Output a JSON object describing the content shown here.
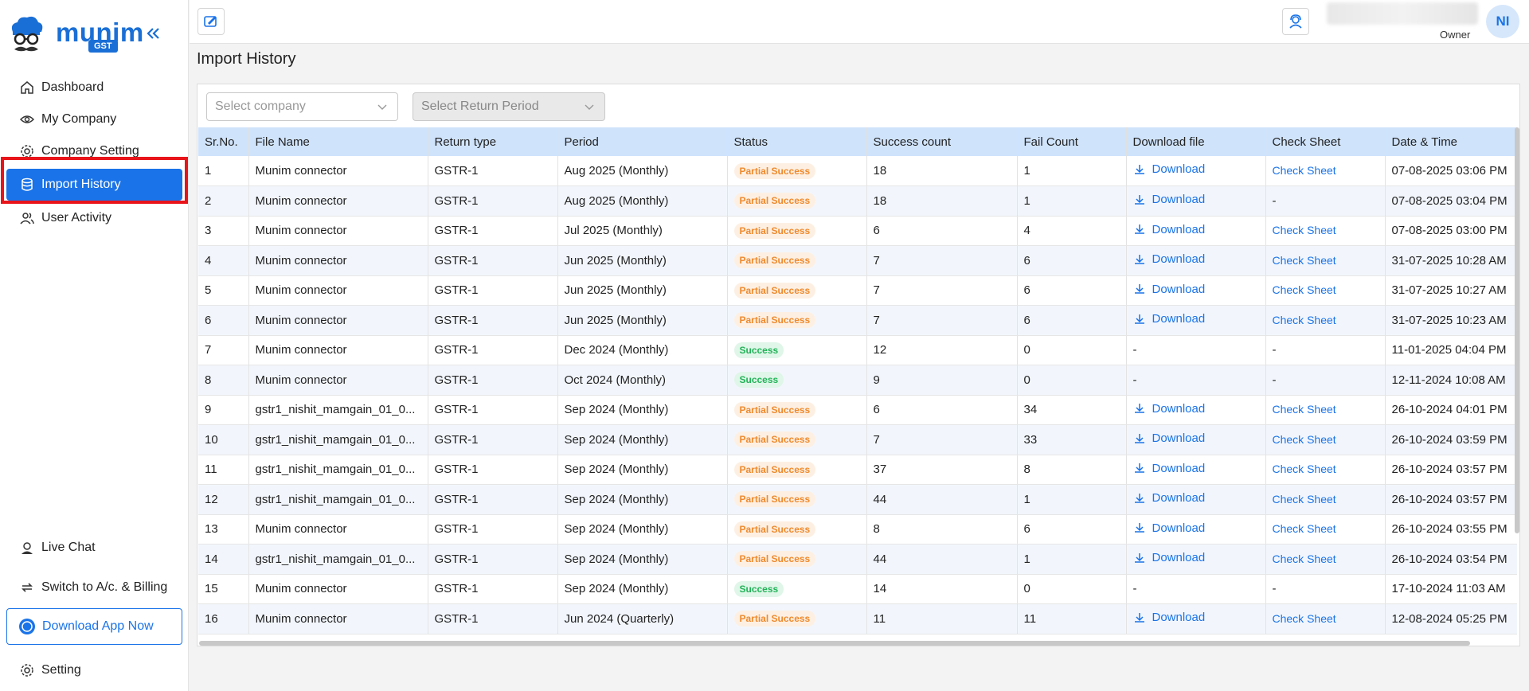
{
  "brand": {
    "name": "munim",
    "badge": "GST",
    "color": "#1a6fd6"
  },
  "sidebar": {
    "items": [
      {
        "label": "Dashboard",
        "icon": "home-icon"
      },
      {
        "label": "My Company",
        "icon": "eye-icon"
      },
      {
        "label": "Company Setting",
        "icon": "gear-icon"
      },
      {
        "label": "Import History",
        "icon": "database-icon",
        "active": true
      },
      {
        "label": "User Activity",
        "icon": "users-icon"
      }
    ],
    "bottom": {
      "live_chat": "Live Chat",
      "switch": "Switch to A/c. & Billing",
      "download_app": "Download App Now",
      "setting": "Setting"
    }
  },
  "topbar": {
    "role": "Owner",
    "avatar_initials": "NI"
  },
  "page": {
    "title": "Import History"
  },
  "filters": {
    "company_placeholder": "Select company",
    "period_placeholder": "Select Return Period"
  },
  "table": {
    "headers": [
      "Sr.No.",
      "File Name",
      "Return type",
      "Period",
      "Status",
      "Success count",
      "Fail Count",
      "Download file",
      "Check Sheet",
      "Date & Time"
    ],
    "download_label": "Download",
    "check_label": "Check Sheet",
    "rows": [
      {
        "sr": "1",
        "file": "Munim connector",
        "type": "GSTR-1",
        "period": "Aug 2025 (Monthly)",
        "status": "Partial Success",
        "success": "18",
        "fail": "1",
        "download": true,
        "check": true,
        "date": "07-08-2025 03:06 PM"
      },
      {
        "sr": "2",
        "file": "Munim connector",
        "type": "GSTR-1",
        "period": "Aug 2025 (Monthly)",
        "status": "Partial Success",
        "success": "18",
        "fail": "1",
        "download": true,
        "check": false,
        "date": "07-08-2025 03:04 PM"
      },
      {
        "sr": "3",
        "file": "Munim connector",
        "type": "GSTR-1",
        "period": "Jul 2025 (Monthly)",
        "status": "Partial Success",
        "success": "6",
        "fail": "4",
        "download": true,
        "check": true,
        "date": "07-08-2025 03:00 PM"
      },
      {
        "sr": "4",
        "file": "Munim connector",
        "type": "GSTR-1",
        "period": "Jun 2025 (Monthly)",
        "status": "Partial Success",
        "success": "7",
        "fail": "6",
        "download": true,
        "check": true,
        "date": "31-07-2025 10:28 AM"
      },
      {
        "sr": "5",
        "file": "Munim connector",
        "type": "GSTR-1",
        "period": "Jun 2025 (Monthly)",
        "status": "Partial Success",
        "success": "7",
        "fail": "6",
        "download": true,
        "check": true,
        "date": "31-07-2025 10:27 AM"
      },
      {
        "sr": "6",
        "file": "Munim connector",
        "type": "GSTR-1",
        "period": "Jun 2025 (Monthly)",
        "status": "Partial Success",
        "success": "7",
        "fail": "6",
        "download": true,
        "check": true,
        "date": "31-07-2025 10:23 AM"
      },
      {
        "sr": "7",
        "file": "Munim connector",
        "type": "GSTR-1",
        "period": "Dec 2024 (Monthly)",
        "status": "Success",
        "success": "12",
        "fail": "0",
        "download": false,
        "check": false,
        "date": "11-01-2025 04:04 PM"
      },
      {
        "sr": "8",
        "file": "Munim connector",
        "type": "GSTR-1",
        "period": "Oct 2024 (Monthly)",
        "status": "Success",
        "success": "9",
        "fail": "0",
        "download": false,
        "check": false,
        "date": "12-11-2024 10:08 AM"
      },
      {
        "sr": "9",
        "file": "gstr1_nishit_mamgain_01_0...",
        "type": "GSTR-1",
        "period": "Sep 2024 (Monthly)",
        "status": "Partial Success",
        "success": "6",
        "fail": "34",
        "download": true,
        "check": true,
        "date": "26-10-2024 04:01 PM"
      },
      {
        "sr": "10",
        "file": "gstr1_nishit_mamgain_01_0...",
        "type": "GSTR-1",
        "period": "Sep 2024 (Monthly)",
        "status": "Partial Success",
        "success": "7",
        "fail": "33",
        "download": true,
        "check": true,
        "date": "26-10-2024 03:59 PM"
      },
      {
        "sr": "11",
        "file": "gstr1_nishit_mamgain_01_0...",
        "type": "GSTR-1",
        "period": "Sep 2024 (Monthly)",
        "status": "Partial Success",
        "success": "37",
        "fail": "8",
        "download": true,
        "check": true,
        "date": "26-10-2024 03:57 PM"
      },
      {
        "sr": "12",
        "file": "gstr1_nishit_mamgain_01_0...",
        "type": "GSTR-1",
        "period": "Sep 2024 (Monthly)",
        "status": "Partial Success",
        "success": "44",
        "fail": "1",
        "download": true,
        "check": true,
        "date": "26-10-2024 03:57 PM"
      },
      {
        "sr": "13",
        "file": "Munim connector",
        "type": "GSTR-1",
        "period": "Sep 2024 (Monthly)",
        "status": "Partial Success",
        "success": "8",
        "fail": "6",
        "download": true,
        "check": true,
        "date": "26-10-2024 03:55 PM"
      },
      {
        "sr": "14",
        "file": "gstr1_nishit_mamgain_01_0...",
        "type": "GSTR-1",
        "period": "Sep 2024 (Monthly)",
        "status": "Partial Success",
        "success": "44",
        "fail": "1",
        "download": true,
        "check": true,
        "date": "26-10-2024 03:54 PM"
      },
      {
        "sr": "15",
        "file": "Munim connector",
        "type": "GSTR-1",
        "period": "Sep 2024 (Monthly)",
        "status": "Success",
        "success": "14",
        "fail": "0",
        "download": false,
        "check": false,
        "date": "17-10-2024 11:03 AM"
      },
      {
        "sr": "16",
        "file": "Munim connector",
        "type": "GSTR-1",
        "period": "Jun 2024 (Quarterly)",
        "status": "Partial Success",
        "success": "11",
        "fail": "11",
        "download": true,
        "check": true,
        "date": "12-08-2024 05:25 PM"
      }
    ],
    "empty_cell": "-"
  },
  "colors": {
    "accent": "#1a73e8",
    "header_bg": "#cfe3fb",
    "partial": "#ef8a2d",
    "success": "#22b358",
    "highlight": "#e8141a"
  }
}
